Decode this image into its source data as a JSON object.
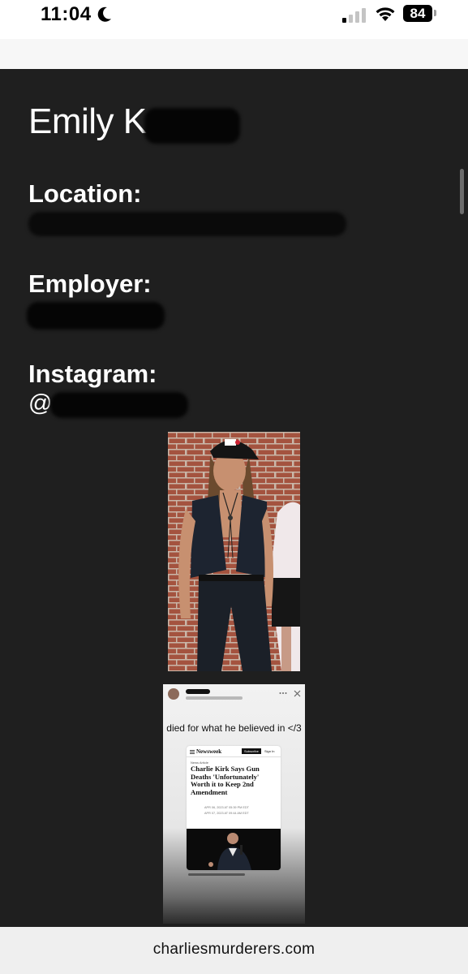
{
  "status_bar": {
    "time": "11:04",
    "battery": "84",
    "icons": [
      "moon-icon",
      "cellular-signal-icon",
      "wifi-icon",
      "battery-icon"
    ]
  },
  "profile": {
    "name": "Emily K",
    "location_label": "Location:",
    "employer_label": "Employer:",
    "instagram_label": "Instagram:",
    "instagram_prefix": "@"
  },
  "story": {
    "caption": "died for what he believed in </3",
    "article": {
      "publication": "Newsweek",
      "subscribe": "Subscribe",
      "sign_in": "Sign In",
      "kicker": "News Article",
      "headline": "Charlie Kirk Says Gun Deaths 'Unfortunately' Worth it to Keep 2nd Amendment",
      "published": "APR 06, 2023 AT 05:39 PM EDT",
      "updated": "APR 07, 2023 AT 09:44 AM EDT"
    }
  },
  "browser": {
    "url": "charliesmurderers.com"
  },
  "colors": {
    "page_background": "#1f1f1f",
    "text": "#ffffff",
    "url_bar": "#efefef"
  }
}
